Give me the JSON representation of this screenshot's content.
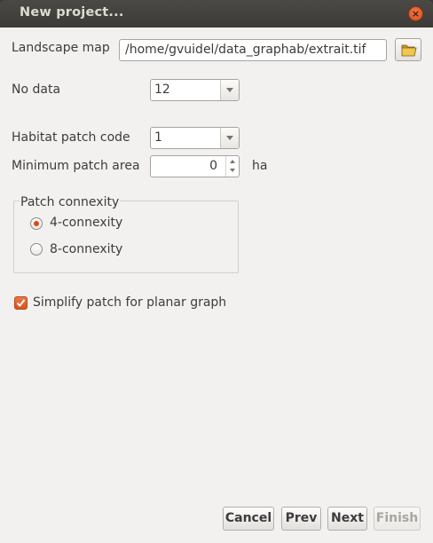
{
  "window": {
    "title": "New project...",
    "close_glyph": "×"
  },
  "form": {
    "landscape_map": {
      "label": "Landscape map",
      "value": "/home/gvuidel/data_graphab/extrait.tif",
      "browse_icon": "folder-open-icon"
    },
    "no_data": {
      "label": "No data",
      "value": "12"
    },
    "habitat_patch_code": {
      "label": "Habitat patch code",
      "value": "1"
    },
    "minimum_patch_area": {
      "label": "Minimum patch area",
      "value": "0",
      "unit": "ha"
    },
    "patch_connexity": {
      "title": "Patch connexity",
      "options": [
        {
          "label": "4-connexity",
          "selected": true
        },
        {
          "label": "8-connexity",
          "selected": false
        }
      ]
    },
    "simplify": {
      "label": "Simplify patch for planar graph",
      "checked": true
    }
  },
  "buttons": {
    "cancel": "Cancel",
    "prev": "Prev",
    "next": "Next",
    "finish": "Finish"
  },
  "colors": {
    "accent": "#dd4814",
    "titlebar": "#3c3b37",
    "dialog_bg": "#f2f1f0"
  }
}
